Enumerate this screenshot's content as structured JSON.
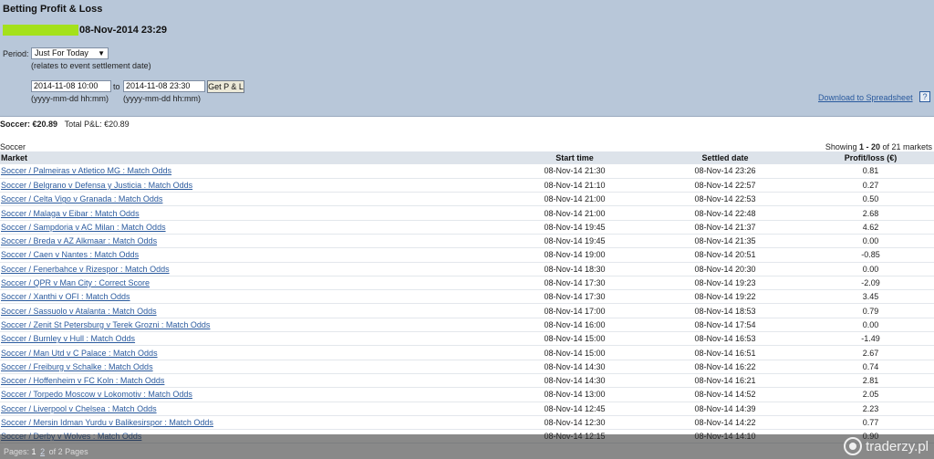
{
  "page": {
    "title": "Betting Profit & Loss",
    "datetime": "08-Nov-2014 23:29"
  },
  "filters": {
    "period_label": "Period:",
    "period_value": "Just For Today",
    "period_hint": "(relates to event settlement date)",
    "from_value": "2014-11-08 10:00",
    "to_label": "to",
    "to_value": "2014-11-08 23:30",
    "get_button": "Get P & L",
    "from_format": "(yyyy-mm-dd hh:mm)",
    "to_format": "(yyyy-mm-dd hh:mm)"
  },
  "download": {
    "label": "Download to Spreadsheet",
    "help": "?"
  },
  "summary": {
    "sport_total": "Soccer: €20.89",
    "total_pl": "Total P&L:  €20.89"
  },
  "section": {
    "label": "Soccer",
    "showing_prefix": "Showing ",
    "showing_range": "1 - 20",
    "showing_suffix": " of 21 markets"
  },
  "table": {
    "columns": [
      "Market",
      "Start time",
      "Settled date",
      "Profit/loss (€)"
    ],
    "rows": [
      [
        "Soccer / Palmeiras v Atletico MG : Match Odds",
        "08-Nov-14 21:30",
        "08-Nov-14 23:26",
        "0.81"
      ],
      [
        "Soccer / Belgrano v Defensa y Justicia : Match Odds",
        "08-Nov-14 21:10",
        "08-Nov-14 22:57",
        "0.27"
      ],
      [
        "Soccer / Celta Vigo v Granada : Match Odds",
        "08-Nov-14 21:00",
        "08-Nov-14 22:53",
        "0.50"
      ],
      [
        "Soccer / Malaga v Eibar : Match Odds",
        "08-Nov-14 21:00",
        "08-Nov-14 22:48",
        "2.68"
      ],
      [
        "Soccer / Sampdoria v AC Milan : Match Odds",
        "08-Nov-14 19:45",
        "08-Nov-14 21:37",
        "4.62"
      ],
      [
        "Soccer / Breda v AZ Alkmaar : Match Odds",
        "08-Nov-14 19:45",
        "08-Nov-14 21:35",
        "0.00"
      ],
      [
        "Soccer / Caen v Nantes : Match Odds",
        "08-Nov-14 19:00",
        "08-Nov-14 20:51",
        "-0.85"
      ],
      [
        "Soccer / Fenerbahce v Rizespor : Match Odds",
        "08-Nov-14 18:30",
        "08-Nov-14 20:30",
        "0.00"
      ],
      [
        "Soccer / QPR v Man City : Correct Score",
        "08-Nov-14 17:30",
        "08-Nov-14 19:23",
        "-2.09"
      ],
      [
        "Soccer / Xanthi v OFI : Match Odds",
        "08-Nov-14 17:30",
        "08-Nov-14 19:22",
        "3.45"
      ],
      [
        "Soccer / Sassuolo v Atalanta : Match Odds",
        "08-Nov-14 17:00",
        "08-Nov-14 18:53",
        "0.79"
      ],
      [
        "Soccer / Zenit St Petersburg v Terek Grozni : Match Odds",
        "08-Nov-14 16:00",
        "08-Nov-14 17:54",
        "0.00"
      ],
      [
        "Soccer / Burnley v Hull : Match Odds",
        "08-Nov-14 15:00",
        "08-Nov-14 16:53",
        "-1.49"
      ],
      [
        "Soccer / Man Utd v C Palace : Match Odds",
        "08-Nov-14 15:00",
        "08-Nov-14 16:51",
        "2.67"
      ],
      [
        "Soccer / Freiburg v Schalke : Match Odds",
        "08-Nov-14 14:30",
        "08-Nov-14 16:22",
        "0.74"
      ],
      [
        "Soccer / Hoffenheim v FC Koln : Match Odds",
        "08-Nov-14 14:30",
        "08-Nov-14 16:21",
        "2.81"
      ],
      [
        "Soccer / Torpedo Moscow v Lokomotiv : Match Odds",
        "08-Nov-14 13:00",
        "08-Nov-14 14:52",
        "2.05"
      ],
      [
        "Soccer / Liverpool v Chelsea : Match Odds",
        "08-Nov-14 12:45",
        "08-Nov-14 14:39",
        "2.23"
      ],
      [
        "Soccer / Mersin Idman Yurdu v Balikesirspor : Match Odds",
        "08-Nov-14 12:30",
        "08-Nov-14 14:22",
        "0.77"
      ],
      [
        "Soccer / Derby v Wolves : Match Odds",
        "08-Nov-14 12:15",
        "08-Nov-14 14:10",
        "0.90"
      ]
    ]
  },
  "pager": {
    "label": "Pages:",
    "current": "1",
    "next": "2",
    "total": "of 2 Pages"
  },
  "watermark": {
    "text": "traderzy.pl"
  },
  "colors": {
    "header_bg": "#b8c7d9",
    "link": "#2a5a9e",
    "redacted_block": "#a4e11b",
    "table_header_bg": "#dde3ea"
  }
}
